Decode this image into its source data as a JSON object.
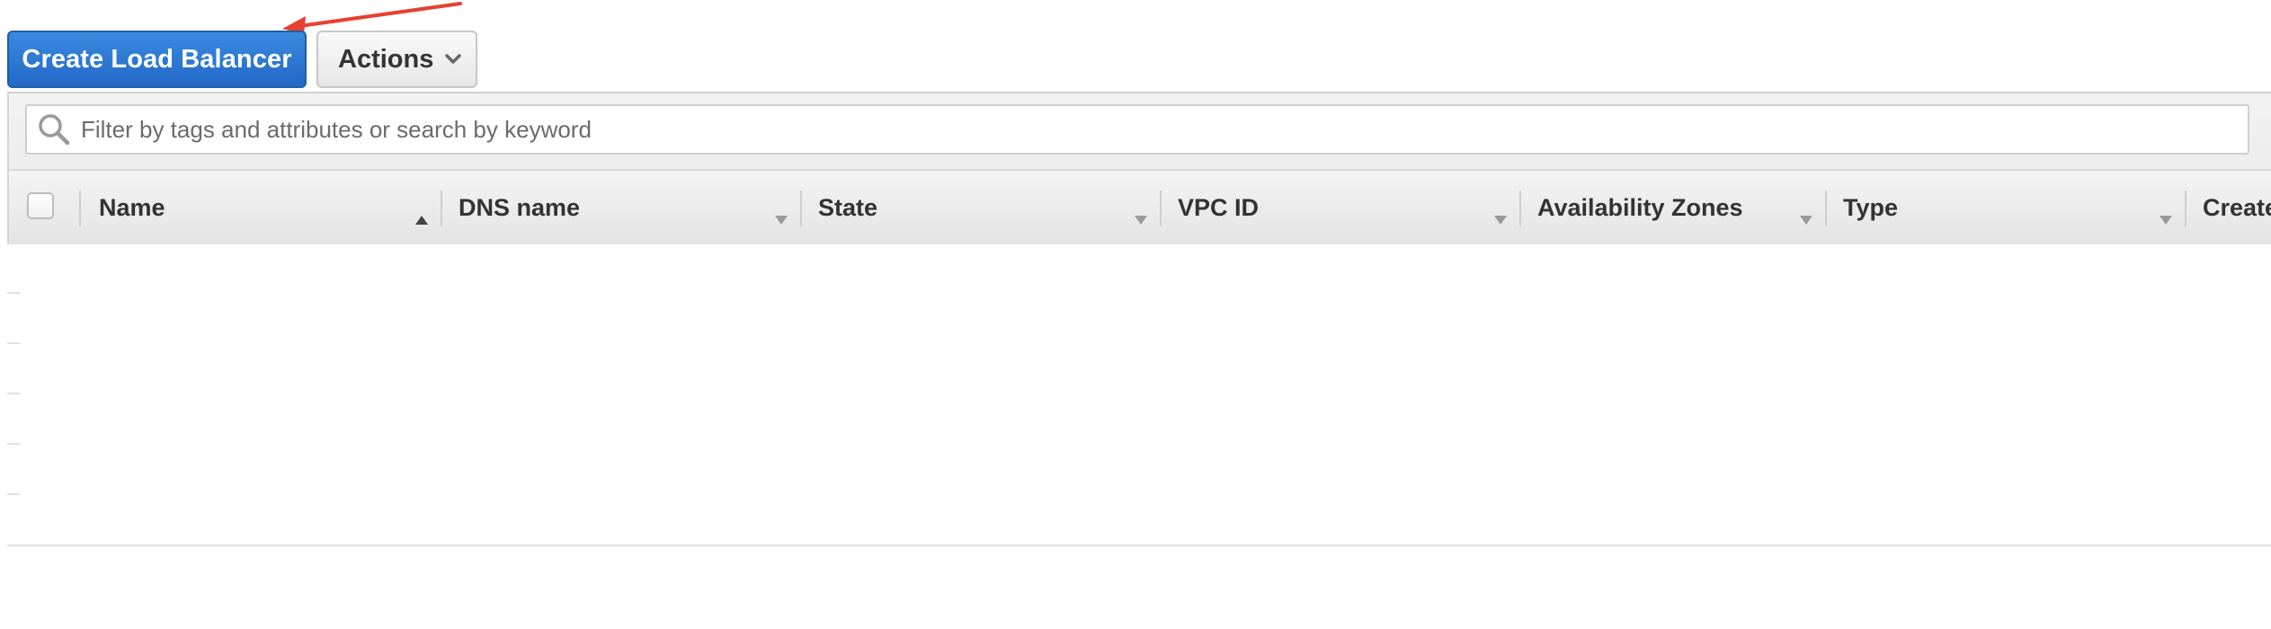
{
  "toolbar": {
    "create_label": "Create Load Balancer",
    "actions_label": "Actions"
  },
  "icons": {
    "search": "search-icon",
    "actions_caret": "chevron-down-icon",
    "sort_ascending": "sort-ascending-icon",
    "sort_descending": "sort-descending-icon"
  },
  "search": {
    "placeholder": "Filter by tags and attributes or search by keyword",
    "value": ""
  },
  "table": {
    "columns": [
      {
        "label": "Name",
        "sort": "ascending"
      },
      {
        "label": "DNS name",
        "sort": "none"
      },
      {
        "label": "State",
        "sort": "none"
      },
      {
        "label": "VPC ID",
        "sort": "none"
      },
      {
        "label": "Availability Zones",
        "sort": "none"
      },
      {
        "label": "Type",
        "sort": "none"
      },
      {
        "label": "Create",
        "sort": "none"
      }
    ],
    "rows": []
  },
  "colors": {
    "primary_button": "#2268c7",
    "annotation_arrow": "#e8402f",
    "header_text": "#333333"
  }
}
